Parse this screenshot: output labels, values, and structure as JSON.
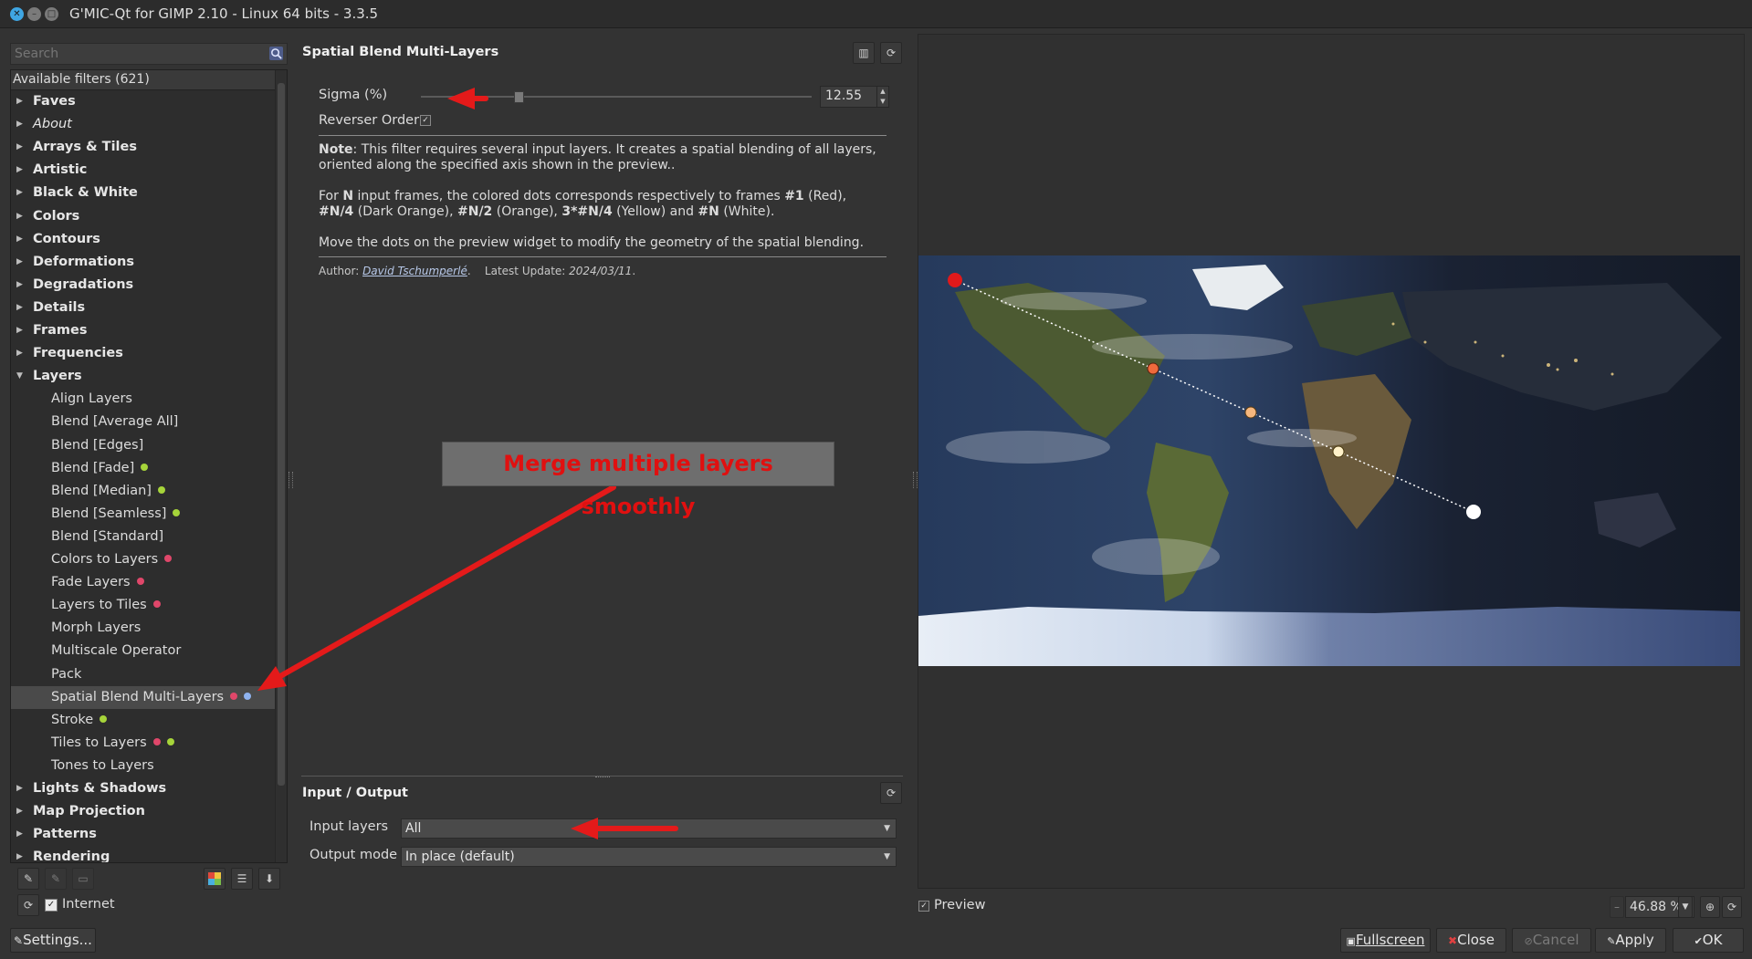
{
  "window": {
    "title": "G'MIC-Qt for GIMP 2.10 - Linux 64 bits - 3.3.5"
  },
  "search": {
    "placeholder": "Search"
  },
  "tree": {
    "header": "Available filters (621)",
    "categories_top": [
      "Faves",
      "About",
      "Arrays & Tiles",
      "Artistic",
      "Black & White",
      "Colors",
      "Contours",
      "Deformations",
      "Degradations",
      "Details",
      "Frames",
      "Frequencies",
      "Layers"
    ],
    "layers_items": [
      "Align Layers",
      "Blend [Average All]",
      "Blend [Edges]",
      "Blend [Fade]",
      "Blend [Median]",
      "Blend [Seamless]",
      "Blend [Standard]",
      "Colors to Layers",
      "Fade Layers",
      "Layers to Tiles",
      "Morph Layers",
      "Multiscale Operator",
      "Pack",
      "Spatial Blend Multi-Layers",
      "Stroke",
      "Tiles to Layers",
      "Tones to Layers"
    ],
    "categories_bottom": [
      "Lights & Shadows",
      "Map Projection",
      "Patterns",
      "Rendering"
    ]
  },
  "internet": {
    "label": "Internet",
    "checked": true
  },
  "buttons": {
    "settings": "Settings...",
    "fullscreen": "Fullscreen",
    "close": "Close",
    "cancel": "Cancel",
    "apply": "Apply",
    "ok": "OK"
  },
  "filter": {
    "title": "Spatial Blend Multi-Layers",
    "sigma_label": "Sigma (%)",
    "sigma_value": "12.55",
    "sigma_fraction": 0.25,
    "reverse_label": "Reverser Order",
    "reverse_checked": true,
    "note_bold": "Note",
    "note_text": ": This filter requires several input layers. It creates a spatial blending of all layers, oriented along the specified axis shown in the preview..",
    "p2_a": "For ",
    "p2_N": "N",
    "p2_b": " input frames, the colored dots corresponds respectively to frames ",
    "p2_f1": "#1",
    "p2_c": " (Red), ",
    "p2_f2": "#N/4",
    "p2_d": " (Dark Orange), ",
    "p2_f3": "#N/2",
    "p2_e": " (Orange), ",
    "p2_f4": "3*#N/4",
    "p2_g": " (Yellow) and ",
    "p2_f5": "#N",
    "p2_h": " (White).",
    "p3": "Move the dots on the preview widget to modify the geometry of the spatial blending.",
    "author_label": "Author:",
    "author_name": "David Tschumperlé",
    "update_label": "Latest Update:",
    "update_date": "2024/03/11"
  },
  "io": {
    "title": "Input / Output",
    "input_label": "Input layers",
    "input_value": "All",
    "output_label": "Output mode",
    "output_value": "In place (default)"
  },
  "preview": {
    "label": "Preview",
    "checked": true,
    "zoom": "46.88 %"
  },
  "annotation": {
    "text": "Merge multiple layers smoothly"
  },
  "colors": {
    "red": "#e0191b",
    "dark_orange": "#f06a3c",
    "orange": "#f6b77e",
    "yellow": "#fff1c9",
    "white": "#ffffff",
    "dot_pink": "#e0476a",
    "dot_green": "#a6d43a",
    "dot_blue": "#8fb3f0"
  },
  "icons": [
    "close-icon",
    "minimize-icon",
    "maximize-icon",
    "search-icon",
    "refresh-icon",
    "layout-icon",
    "dropdown-icon"
  ]
}
